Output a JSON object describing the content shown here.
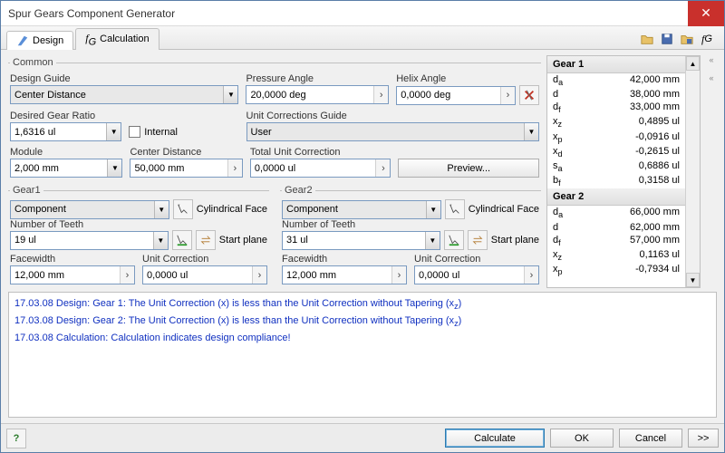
{
  "window": {
    "title": "Spur Gears Component Generator"
  },
  "tabs": {
    "design": "Design",
    "calculation": "Calculation"
  },
  "common": {
    "legend": "Common",
    "design_guide_label": "Design Guide",
    "design_guide": "Center Distance",
    "pressure_angle_label": "Pressure Angle",
    "pressure_angle": "20,0000 deg",
    "helix_angle_label": "Helix Angle",
    "helix_angle": "0,0000 deg",
    "desired_ratio_label": "Desired Gear Ratio",
    "desired_ratio": "1,6316 ul",
    "internal_label": "Internal",
    "unit_corr_guide_label": "Unit Corrections Guide",
    "unit_corr_guide": "User",
    "module_label": "Module",
    "module": "2,000 mm",
    "center_distance_label": "Center Distance",
    "center_distance": "50,000 mm",
    "total_unit_corr_label": "Total Unit Correction",
    "total_unit_corr": "0,0000 ul",
    "preview_label": "Preview..."
  },
  "gear1": {
    "legend": "Gear1",
    "type": "Component",
    "cyl_face": "Cylindrical Face",
    "teeth_label": "Number of Teeth",
    "teeth": "19 ul",
    "start_plane": "Start plane",
    "facewidth_label": "Facewidth",
    "facewidth": "12,000 mm",
    "unit_corr_label": "Unit Correction",
    "unit_corr": "0,0000 ul"
  },
  "gear2": {
    "legend": "Gear2",
    "type": "Component",
    "cyl_face": "Cylindrical Face",
    "teeth_label": "Number of Teeth",
    "teeth": "31 ul",
    "start_plane": "Start plane",
    "facewidth_label": "Facewidth",
    "facewidth": "12,000 mm",
    "unit_corr_label": "Unit Correction",
    "unit_corr": "0,0000 ul"
  },
  "results": {
    "gear1_header": "Gear 1",
    "gear2_header": "Gear 2",
    "g1": {
      "da": "42,000 mm",
      "d": "38,000 mm",
      "df": "33,000 mm",
      "xz": "0,4895 ul",
      "xp": "-0,0916 ul",
      "xd": "-0,2615 ul",
      "sa": "0,6886 ul",
      "bf": "0,3158 ul"
    },
    "g2": {
      "da": "66,000 mm",
      "d": "62,000 mm",
      "df": "57,000 mm",
      "xz": "0,1163 ul",
      "xp": "-0,7934 ul"
    }
  },
  "messages": {
    "m1a": "17.03.08 Design: Gear 1: The Unit Correction (x) is less than the Unit Correction without Tapering (x",
    "m1b": ")",
    "m2a": "17.03.08 Design: Gear 2: The Unit Correction (x) is less than the Unit Correction without Tapering (x",
    "m2b": ")",
    "m3": "17.03.08 Calculation: Calculation indicates design compliance!"
  },
  "footer": {
    "calculate": "Calculate",
    "ok": "OK",
    "cancel": "Cancel",
    "more": ">>"
  }
}
